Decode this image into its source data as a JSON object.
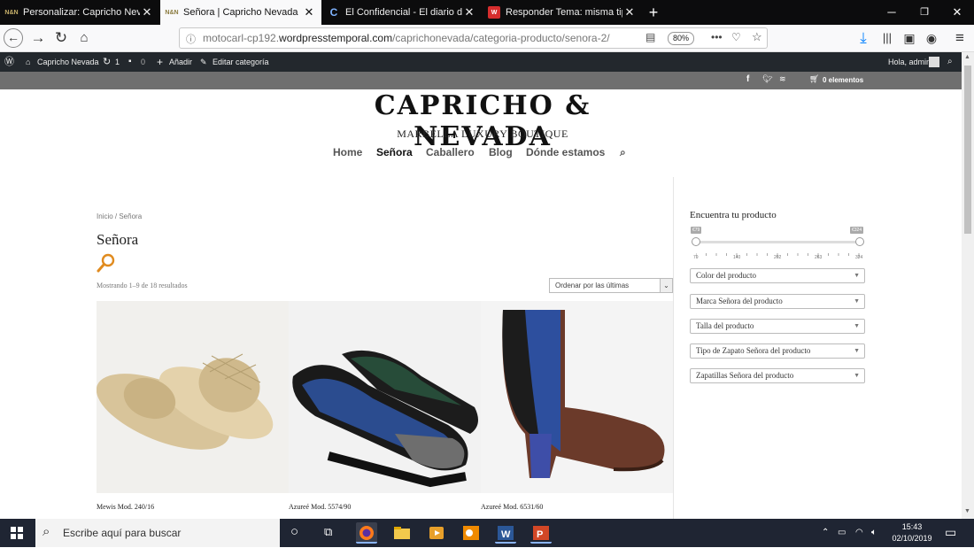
{
  "browser": {
    "tabs": [
      {
        "label": "Personalizar: Capricho Nevada",
        "favicon": "N&N"
      },
      {
        "label": "Señora | Capricho Nevada",
        "favicon": "N&N",
        "active": true
      },
      {
        "label": "El Confidencial - El diario de los",
        "favicon": "C"
      },
      {
        "label": "Responder Tema: misma tipogr",
        "favicon": "W"
      }
    ],
    "new_tab": "+",
    "url_dim_prefix": "motocarl-cp192.",
    "url_domain": "wordpresstemporal.com",
    "url_path": "/caprichonevada/categoria-producto/senora-2/",
    "zoom": "80%",
    "page_actions": "•••"
  },
  "adminbar": {
    "site": "Capricho Nevada",
    "updates": "1",
    "comments": "0",
    "add": "Añadir",
    "edit": "Editar categoría",
    "greeting": "Hola, admin"
  },
  "topbar": {
    "cart": "0 elementos"
  },
  "site": {
    "logo": "CAPRICHO & NEVADA",
    "tagline": "MARBELLA LUXURY BOUTIQUE",
    "menu": [
      "Home",
      "Señora",
      "Caballero",
      "Blog",
      "Dónde estamos"
    ],
    "current_menu": "Señora"
  },
  "page": {
    "breadcrumb": "Inicio / Señora",
    "title": "Señora",
    "result_count": "Mostrando 1–9 de 18 resultados",
    "sort": "Ordenar por las últimas",
    "products": [
      {
        "name": "Mewis Mod. 240/16"
      },
      {
        "name": "Azureé Mod. 5574/90"
      },
      {
        "name": "Azureé Mod. 6531/60"
      }
    ]
  },
  "sidebar": {
    "title": "Encuentra tu producto",
    "price_min": "€79",
    "price_max": "€324",
    "ticks": [
      "79",
      "140",
      "202",
      "263",
      "324"
    ],
    "filters": [
      "Color del producto",
      "Marca Señora del producto",
      "Talla del producto",
      "Tipo de Zapato Señora del producto",
      "Zapatillas Señora del producto"
    ]
  },
  "taskbar": {
    "search_placeholder": "Escribe aquí para buscar",
    "time": "15:43",
    "date": "02/10/2019"
  }
}
